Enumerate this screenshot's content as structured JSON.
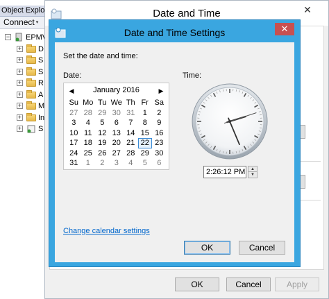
{
  "object_explorer": {
    "title": "Object Explor",
    "toolbar_connect": "Connect",
    "toolbar_glyph": "▾",
    "toolbar_more": "‹",
    "root_label": "EPMV",
    "items": [
      "D",
      "S",
      "S",
      "R",
      "A",
      "M",
      "In",
      "S"
    ],
    "expander_glyph": "+",
    "minus_glyph": "−"
  },
  "date_time_window": {
    "title": "Date and Time",
    "close_glyph": "✕",
    "ok_label": "OK",
    "cancel_label": "Cancel",
    "apply_label": "Apply"
  },
  "dialog": {
    "title": "Date and Time Settings",
    "close_glyph": "✕",
    "prompt": "Set the date and time:",
    "date_label": "Date:",
    "time_label": "Time:",
    "calendar": {
      "month_label": "January 2016",
      "prev_glyph": "◀",
      "next_glyph": "▶",
      "weekdays": [
        "Su",
        "Mo",
        "Tu",
        "We",
        "Th",
        "Fr",
        "Sa"
      ],
      "weeks": [
        [
          "27",
          "28",
          "29",
          "30",
          "31",
          "1",
          "2"
        ],
        [
          "3",
          "4",
          "5",
          "6",
          "7",
          "8",
          "9"
        ],
        [
          "10",
          "11",
          "12",
          "13",
          "14",
          "15",
          "16"
        ],
        [
          "17",
          "18",
          "19",
          "20",
          "21",
          "22",
          "23"
        ],
        [
          "24",
          "25",
          "26",
          "27",
          "28",
          "29",
          "30"
        ],
        [
          "31",
          "1",
          "2",
          "3",
          "4",
          "5",
          "6"
        ]
      ],
      "selected_day": "22"
    },
    "clock": {
      "hour": 2,
      "minute": 26,
      "second": 12
    },
    "time_value": "2:26:12 PM",
    "spin_up_glyph": "▲",
    "spin_down_glyph": "▼",
    "link_label": "Change calendar settings",
    "ok_label": "OK",
    "cancel_label": "Cancel"
  },
  "colors": {
    "dialog_frame": "#3aa6e0",
    "close_button": "#c75050",
    "link": "#0066cc",
    "selection": "#3a8bd6"
  }
}
